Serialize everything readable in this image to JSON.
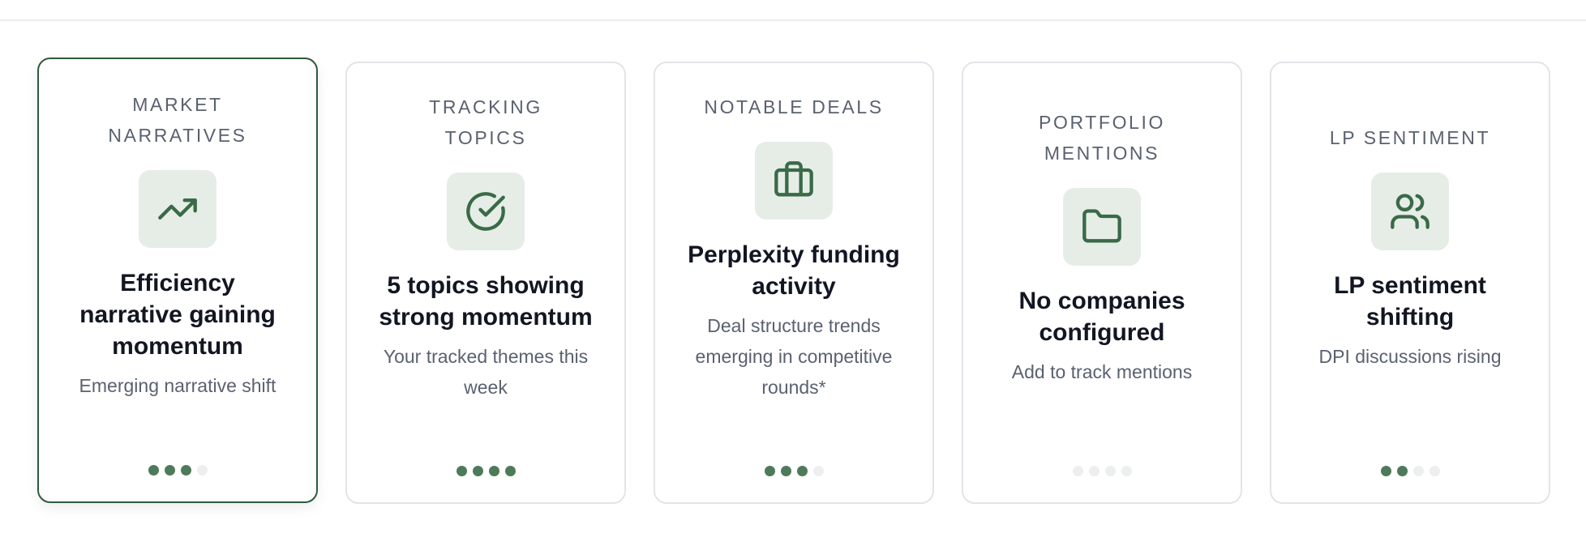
{
  "colors": {
    "accent": "#2f5a3c",
    "icon_tint": "#3a6a48",
    "icon_bg": "#e6ede7",
    "dot_on": "#4e7a5a",
    "dot_off": "#edeef0"
  },
  "cards": [
    {
      "label": "MARKET NARRATIVES",
      "icon": "trending-up-icon",
      "headline": "Efficiency narrative gaining momentum",
      "sub": "Emerging narrative shift",
      "level": 3,
      "level_max": 4,
      "selected": true
    },
    {
      "label": "TRACKING TOPICS",
      "icon": "check-circle-icon",
      "headline": "5 topics showing strong momentum",
      "sub": "Your tracked themes this week",
      "level": 4,
      "level_max": 4,
      "selected": false
    },
    {
      "label": "NOTABLE DEALS",
      "icon": "briefcase-icon",
      "headline": "Perplexity funding activity",
      "sub": "Deal structure trends emerging in competitive rounds*",
      "level": 3,
      "level_max": 4,
      "selected": false
    },
    {
      "label": "PORTFOLIO MENTIONS",
      "icon": "folder-icon",
      "headline": "No companies configured",
      "sub": "Add to track mentions",
      "level": 0,
      "level_max": 4,
      "selected": false
    },
    {
      "label": "LP SENTIMENT",
      "icon": "users-icon",
      "headline": "LP sentiment shifting",
      "sub": "DPI discussions rising",
      "level": 2,
      "level_max": 4,
      "selected": false
    }
  ]
}
